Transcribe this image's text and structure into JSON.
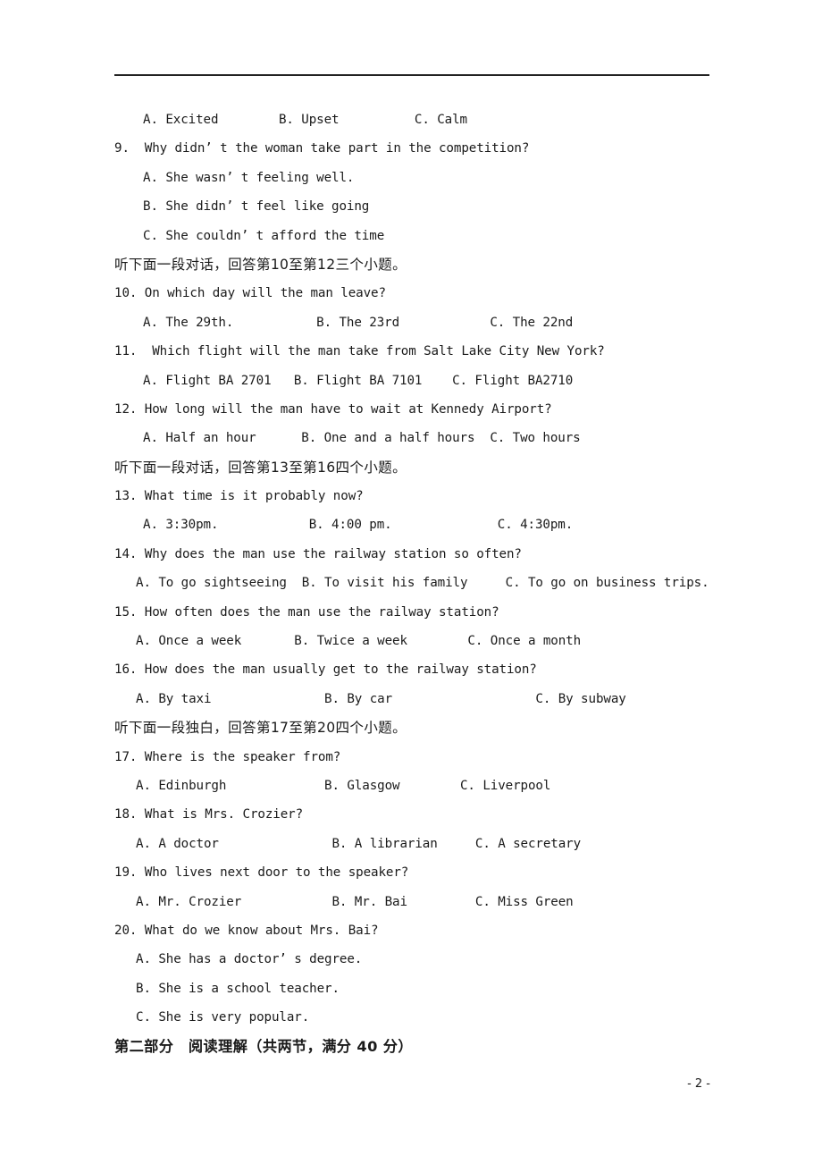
{
  "document": {
    "page_number_label": "- 2 -",
    "header_rule": true
  },
  "lines": [
    {
      "id": "l01",
      "kind": "options",
      "indent": "opt",
      "text": "A. Excited        B. Upset          C. Calm"
    },
    {
      "id": "l02",
      "kind": "stem",
      "indent": "stem",
      "text": "9.  Why didn’ t the woman take part in the competition?"
    },
    {
      "id": "l03",
      "kind": "options",
      "indent": "opt",
      "text": "A. She wasn’ t feeling well."
    },
    {
      "id": "l04",
      "kind": "options",
      "indent": "opt",
      "text": "B. She didn’ t feel like going"
    },
    {
      "id": "l05",
      "kind": "options",
      "indent": "opt",
      "text": "C. She couldn’ t afford the time"
    },
    {
      "id": "l06",
      "kind": "zh",
      "indent": "zh",
      "text": "听下面一段对话，回答第10至第12三个小题。"
    },
    {
      "id": "l07",
      "kind": "stem",
      "indent": "stem",
      "text": "10. On which day will the man leave?"
    },
    {
      "id": "l08",
      "kind": "options",
      "indent": "opt",
      "text": "A. The 29th.           B. The 23rd            C. The 22nd"
    },
    {
      "id": "l09",
      "kind": "stem",
      "indent": "stem",
      "text": "11.  Which flight will the man take from Salt Lake City New York?"
    },
    {
      "id": "l10",
      "kind": "options",
      "indent": "opt",
      "text": "A. Flight BA 2701   B. Flight BA 7101    C. Flight BA2710"
    },
    {
      "id": "l11",
      "kind": "stem",
      "indent": "stem",
      "text": "12. How long will the man have to wait at Kennedy Airport?"
    },
    {
      "id": "l12",
      "kind": "options",
      "indent": "opt",
      "text": "A. Half an hour      B. One and a half hours  C. Two hours"
    },
    {
      "id": "l13",
      "kind": "zh",
      "indent": "zh",
      "text": "听下面一段对话，回答第13至第16四个小题。"
    },
    {
      "id": "l14",
      "kind": "stem",
      "indent": "stem",
      "text": "13. What time is it probably now?"
    },
    {
      "id": "l15",
      "kind": "options",
      "indent": "opt",
      "text": "A. 3:30pm.            B. 4:00 pm.              C. 4:30pm."
    },
    {
      "id": "l16",
      "kind": "stem",
      "indent": "stem",
      "text": "14. Why does the man use the railway station so often?"
    },
    {
      "id": "l17",
      "kind": "options",
      "indent": "opt-a",
      "text": "A. To go sightseeing  B. To visit his family     C. To go on business trips."
    },
    {
      "id": "l18",
      "kind": "stem",
      "indent": "stem",
      "text": "15. How often does the man use the railway station?"
    },
    {
      "id": "l19",
      "kind": "options",
      "indent": "opt-a",
      "text": "A. Once a week       B. Twice a week        C. Once a month"
    },
    {
      "id": "l20",
      "kind": "stem",
      "indent": "stem",
      "text": "16. How does the man usually get to the railway station?"
    },
    {
      "id": "l21",
      "kind": "options",
      "indent": "opt-a",
      "text": "A. By taxi               B. By car                   C. By subway"
    },
    {
      "id": "l22",
      "kind": "zh",
      "indent": "zh",
      "text": "听下面一段独白，回答第17至第20四个小题。"
    },
    {
      "id": "l23",
      "kind": "stem",
      "indent": "stem",
      "text": "17. Where is the speaker from?"
    },
    {
      "id": "l24",
      "kind": "options",
      "indent": "opt-a",
      "text": "A. Edinburgh             B. Glasgow        C. Liverpool"
    },
    {
      "id": "l25",
      "kind": "stem",
      "indent": "stem",
      "text": "18. What is Mrs. Crozier?"
    },
    {
      "id": "l26",
      "kind": "options",
      "indent": "opt-a",
      "text": "A. A doctor               B. A librarian     C. A secretary"
    },
    {
      "id": "l27",
      "kind": "stem",
      "indent": "stem",
      "text": "19. Who lives next door to the speaker?"
    },
    {
      "id": "l28",
      "kind": "options",
      "indent": "opt-a",
      "text": "A. Mr. Crozier            B. Mr. Bai         C. Miss Green"
    },
    {
      "id": "l29",
      "kind": "stem",
      "indent": "stem",
      "text": "20. What do we know about Mrs. Bai?"
    },
    {
      "id": "l30",
      "kind": "options",
      "indent": "opt-a",
      "text": "A. She has a doctor’ s degree."
    },
    {
      "id": "l31",
      "kind": "options",
      "indent": "opt-a",
      "text": "B. She is a school teacher."
    },
    {
      "id": "l32",
      "kind": "options",
      "indent": "opt-a",
      "text": "C. She is very popular."
    },
    {
      "id": "l33",
      "kind": "zh-heading",
      "indent": "zh",
      "text": "第二部分　阅读理解（共两节，满分 40 分）"
    }
  ]
}
